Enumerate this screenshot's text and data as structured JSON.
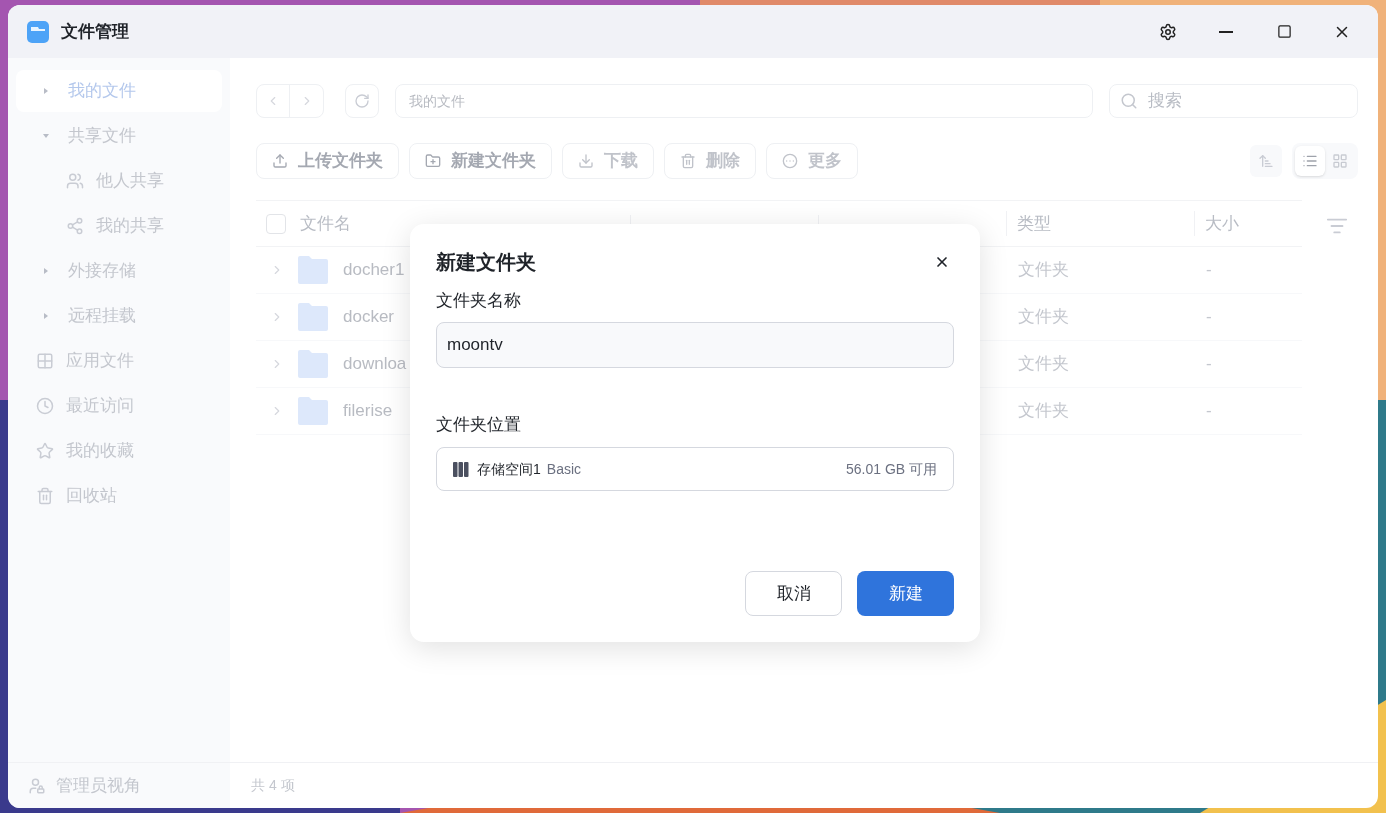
{
  "window": {
    "title": "文件管理"
  },
  "sidebar": {
    "items": [
      {
        "label": "我的文件",
        "kind": "tree",
        "selected": true,
        "expanded": false
      },
      {
        "label": "共享文件",
        "kind": "tree",
        "selected": false,
        "expanded": true,
        "children": [
          {
            "label": "他人共享",
            "kind": "people",
            "selected": false
          },
          {
            "label": "我的共享",
            "kind": "share",
            "selected": false
          }
        ]
      },
      {
        "label": "外接存储",
        "kind": "tree",
        "selected": false,
        "expanded": false
      },
      {
        "label": "远程挂载",
        "kind": "tree",
        "selected": false,
        "expanded": false
      },
      {
        "label": "应用文件",
        "kind": "apps",
        "selected": false
      },
      {
        "label": "最近访问",
        "kind": "recent",
        "selected": false
      },
      {
        "label": "我的收藏",
        "kind": "star",
        "selected": false
      },
      {
        "label": "回收站",
        "kind": "trash",
        "selected": false
      }
    ],
    "footer": "管理员视角"
  },
  "path": "我的文件",
  "search": {
    "placeholder": "搜索"
  },
  "toolbar": [
    {
      "label": "上传文件夹",
      "kind": "upload",
      "disabled": false
    },
    {
      "label": "新建文件夹",
      "kind": "new",
      "disabled": false
    },
    {
      "label": "下载",
      "kind": "download",
      "disabled": true
    },
    {
      "label": "删除",
      "kind": "delete",
      "disabled": true
    },
    {
      "label": "更多",
      "kind": "more",
      "disabled": true
    }
  ],
  "view": [
    {
      "kind": "list",
      "selected": true
    },
    {
      "kind": "grid",
      "selected": false
    }
  ],
  "table": {
    "select_all": {
      "checked": false
    },
    "columns": [
      {
        "label": "文件名"
      },
      {
        "label": "类型"
      },
      {
        "label": "大小"
      }
    ],
    "rows": [
      {
        "name": "docher1",
        "type": "文件夹",
        "size": "-"
      },
      {
        "name": "docker",
        "type": "文件夹",
        "size": "-"
      },
      {
        "name": "downloa",
        "type": "文件夹",
        "size": "-"
      },
      {
        "name": "filerise",
        "type": "文件夹",
        "size": "-"
      }
    ]
  },
  "status_bar": "共 4 项",
  "dialog": {
    "title": "新建文件夹",
    "name_label": "文件夹名称",
    "name_value": "moontv",
    "location_label": "文件夹位置",
    "location": {
      "name": "存储空间1",
      "tag": "Basic",
      "free": "56.01 GB 可用"
    },
    "buttons": [
      {
        "label": "取消",
        "kind": "secondary"
      },
      {
        "label": "新建",
        "kind": "primary"
      }
    ]
  }
}
